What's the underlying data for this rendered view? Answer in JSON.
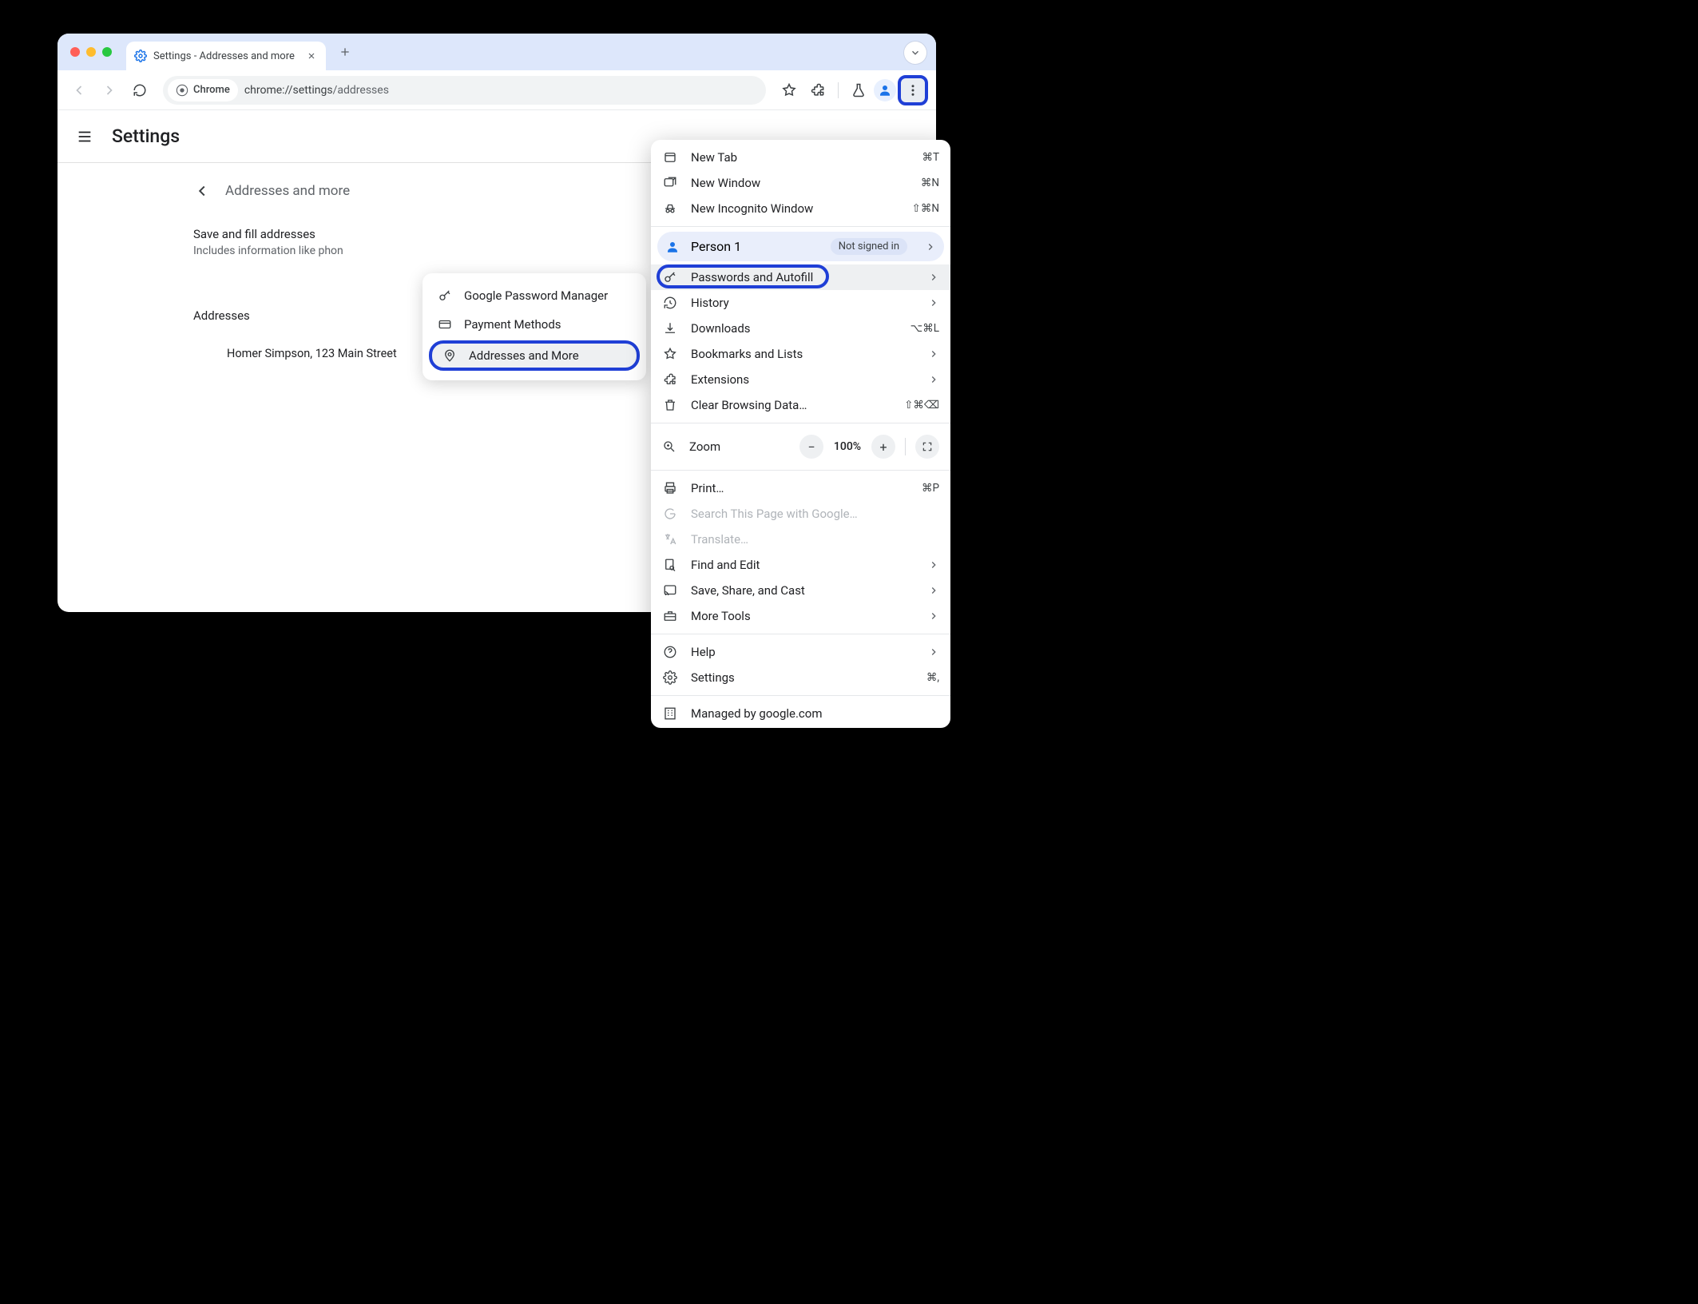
{
  "tab": {
    "title": "Settings - Addresses and more"
  },
  "toolbar": {
    "chrome_chip": "Chrome",
    "url_host": "chrome://settings",
    "url_path": "/addresses"
  },
  "settings": {
    "title": "Settings",
    "breadcrumb": "Addresses and more",
    "save_fill_title": "Save and fill addresses",
    "save_fill_sub": "Includes information like phon",
    "addresses_label": "Addresses",
    "address_entry": "Homer Simpson, 123 Main Street"
  },
  "submenu": {
    "items": [
      {
        "icon": "key",
        "label": "Google Password Manager"
      },
      {
        "icon": "card",
        "label": "Payment Methods"
      },
      {
        "icon": "pin",
        "label": "Addresses and More"
      }
    ]
  },
  "menu": {
    "new_tab": "New Tab",
    "new_tab_sc": "⌘T",
    "new_window": "New Window",
    "new_window_sc": "⌘N",
    "new_incognito": "New Incognito Window",
    "new_incognito_sc": "⇧⌘N",
    "profile_name": "Person 1",
    "profile_badge": "Not signed in",
    "passwords": "Passwords and Autofill",
    "history": "History",
    "downloads": "Downloads",
    "downloads_sc": "⌥⌘L",
    "bookmarks": "Bookmarks and Lists",
    "extensions": "Extensions",
    "clear": "Clear Browsing Data…",
    "clear_sc": "⇧⌘⌫",
    "zoom_label": "Zoom",
    "zoom_value": "100%",
    "print": "Print…",
    "print_sc": "⌘P",
    "search_page": "Search This Page with Google…",
    "translate": "Translate…",
    "find_edit": "Find and Edit",
    "save_share": "Save, Share, and Cast",
    "more_tools": "More Tools",
    "help": "Help",
    "settings": "Settings",
    "settings_sc": "⌘,",
    "managed": "Managed by google.com"
  }
}
